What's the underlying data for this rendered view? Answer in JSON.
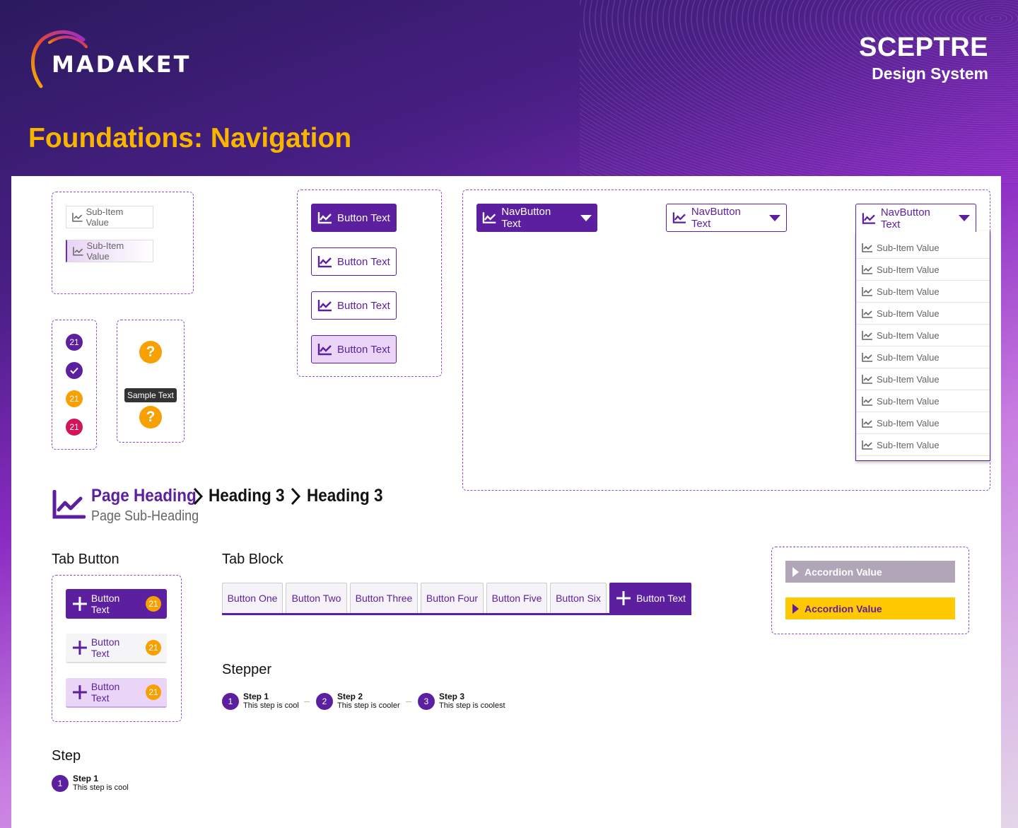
{
  "header": {
    "logo_text": "MADAKET",
    "brand_title": "SCEPTRE",
    "brand_subtitle": "Design System",
    "page_title": "Foundations: Navigation"
  },
  "colors": {
    "primary": "#5b1fa0",
    "accent_orange": "#f7a000",
    "pink": "#d4145a",
    "title_yellow": "#f7b500",
    "accordion_grey": "#b0a6b8",
    "accordion_yellow": "#ffc800"
  },
  "subitems_demo": [
    {
      "label": "Sub-Item Value",
      "state": "default"
    },
    {
      "label": "Sub-Item Value",
      "state": "hover"
    }
  ],
  "badges": [
    {
      "value": "21",
      "color": "#5b1fa0"
    },
    {
      "value": "check",
      "color": "#5b1fa0"
    },
    {
      "value": "21",
      "color": "#f7a000"
    },
    {
      "value": "21",
      "color": "#d4145a"
    }
  ],
  "help": {
    "icon": "question-icon",
    "tooltip": "Sample Text"
  },
  "buttons": [
    {
      "label": "Button Text",
      "variant": "primary"
    },
    {
      "label": "Button Text",
      "variant": "outline"
    },
    {
      "label": "Button Text",
      "variant": "outline"
    },
    {
      "label": "Button Text",
      "variant": "soft"
    }
  ],
  "navbuttons": [
    {
      "label": "NavButton Text",
      "variant": "primary"
    },
    {
      "label": "NavButton Text",
      "variant": "outline"
    },
    {
      "label": "NavButton Text",
      "variant": "open"
    }
  ],
  "dropdown_items": [
    "Sub-Item Value",
    "Sub-Item Value",
    "Sub-Item Value",
    "Sub-Item Value",
    "Sub-Item Value",
    "Sub-Item Value",
    "Sub-Item Value",
    "Sub-Item Value",
    "Sub-Item Value",
    "Sub-Item Value"
  ],
  "page_heading": {
    "title": "Page Heading",
    "subtitle": "Page Sub-Heading",
    "crumb1": "Heading 3",
    "crumb2": "Heading 3"
  },
  "tab_button": {
    "section_label": "Tab Button",
    "items": [
      {
        "label": "Button Text",
        "count": "21",
        "variant": "primary"
      },
      {
        "label": "Button Text",
        "count": "21",
        "variant": "plain"
      },
      {
        "label": "Button Text",
        "count": "21",
        "variant": "soft"
      }
    ]
  },
  "tab_block": {
    "section_label": "Tab Block",
    "tabs": [
      "Button One",
      "Button Two",
      "Button Three",
      "Button Four",
      "Button Five",
      "Button Six"
    ],
    "active_label": "Button Text"
  },
  "stepper": {
    "section_label": "Stepper",
    "steps": [
      {
        "num": "1",
        "title": "Step 1",
        "sub": "This step is cool"
      },
      {
        "num": "2",
        "title": "Step 2",
        "sub": "This step is cooler"
      },
      {
        "num": "3",
        "title": "Step 3",
        "sub": "This step is coolest"
      }
    ]
  },
  "step": {
    "section_label": "Step",
    "num": "1",
    "title": "Step 1",
    "sub": "This step is cool"
  },
  "accordion": [
    {
      "label": "Accordion Value",
      "variant": "grey"
    },
    {
      "label": "Accordion Value",
      "variant": "yellow"
    }
  ]
}
